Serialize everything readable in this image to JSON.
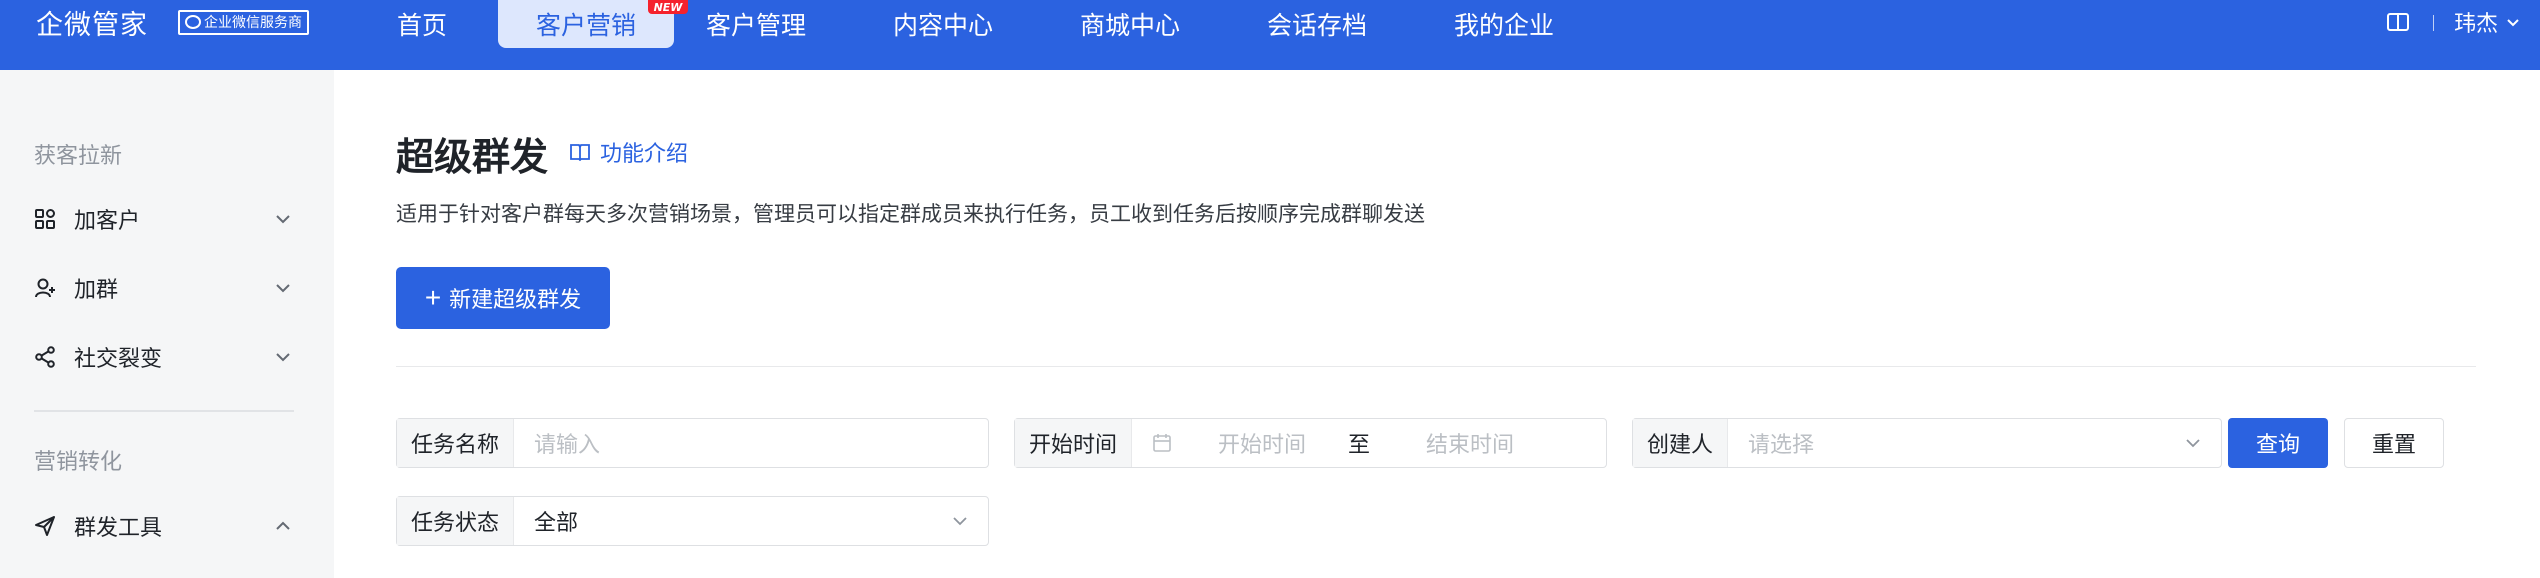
{
  "header": {
    "brand_name": "企微管家",
    "brand_badge": "企业微信服务商",
    "nav": [
      {
        "label": "首页"
      },
      {
        "label": "客户营销",
        "badge": "NEW"
      },
      {
        "label": "客户管理"
      },
      {
        "label": "内容中心"
      },
      {
        "label": "商城中心"
      },
      {
        "label": "会话存档"
      },
      {
        "label": "我的企业"
      }
    ],
    "active_nav": "客户营销",
    "user_name": "玮杰"
  },
  "sidebar": {
    "group_acquire": "获客拉新",
    "items_acquire": [
      {
        "label": "加客户",
        "icon": "apps-icon"
      },
      {
        "label": "加群",
        "icon": "user-add-icon"
      },
      {
        "label": "社交裂变",
        "icon": "share-icon"
      }
    ],
    "group_convert": "营销转化",
    "items_convert": [
      {
        "label": "群发工具",
        "icon": "send-icon",
        "expanded": true
      }
    ]
  },
  "main": {
    "title": "超级群发",
    "intro_link": "功能介绍",
    "description": "适用于针对客户群每天多次营销场景，管理员可以指定群成员来执行任务，员工收到任务后按顺序完成群聊发送",
    "create_button": "新建超级群发",
    "filters": {
      "task_name_label": "任务名称",
      "task_name_placeholder": "请输入",
      "start_time_label": "开始时间",
      "start_placeholder": "开始时间",
      "range_separator": "至",
      "end_placeholder": "结束时间",
      "creator_label": "创建人",
      "creator_placeholder": "请选择",
      "status_label": "任务状态",
      "status_value": "全部"
    },
    "query_button": "查询",
    "reset_button": "重置"
  },
  "colors": {
    "primary": "#2b62e0",
    "nav_active_bg": "#dde7fd",
    "new_badge": "#f5222d",
    "sidebar_bg": "#f5f6f7"
  }
}
